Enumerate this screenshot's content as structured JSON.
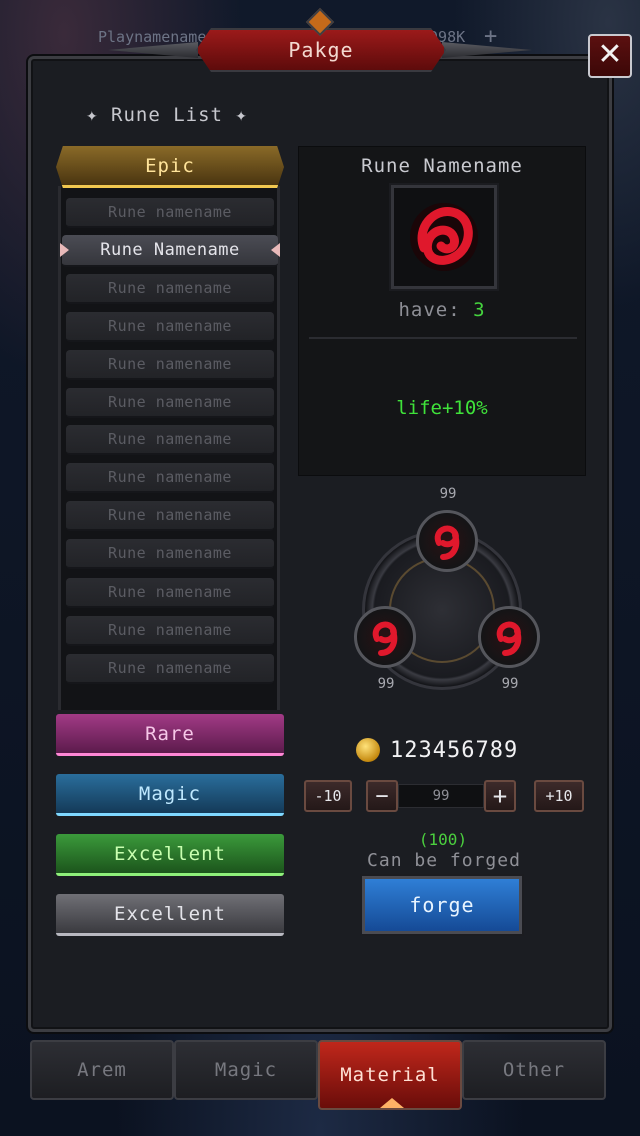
{
  "header": {
    "player_name": "Playnamename",
    "currency": "9098K",
    "plus_symbol": "+",
    "title": "Pakge",
    "close_symbol": "✕"
  },
  "rune_list": {
    "title": "✦ Rune List ✦",
    "categories": [
      {
        "label": "Epic",
        "color": "#f2c850"
      },
      {
        "label": "Rare",
        "color": "#ff87d6"
      },
      {
        "label": "Magic",
        "color": "#7fd8ff"
      },
      {
        "label": "Excellent",
        "color": "#8ff07a"
      },
      {
        "label": "Excellent",
        "color": "#b8b8c0"
      }
    ],
    "items": [
      "Rune namename",
      "Rune Namename",
      "Rune namename",
      "Rune namename",
      "Rune namename",
      "Rune namename",
      "Rune namename",
      "Rune namename",
      "Rune namename",
      "Rune namename",
      "Rune namename",
      "Rune namename",
      "Rune namename"
    ],
    "selected_index": 1
  },
  "detail": {
    "name": "Rune Namename",
    "icon": "red-rune-icon",
    "have_label": "have:",
    "have_value": "3",
    "effect": "life+10%"
  },
  "forge": {
    "materials": [
      {
        "position": "top",
        "count": "99",
        "icon": "rune-glyph-icon"
      },
      {
        "position": "left",
        "count": "99",
        "icon": "rune-glyph-icon"
      },
      {
        "position": "right",
        "count": "99",
        "icon": "rune-glyph-icon"
      }
    ],
    "gold": "123456789",
    "minus10": "-10",
    "minus": "−",
    "quantity": "99",
    "plus": "+",
    "plus10": "+10",
    "count": "(100)",
    "status": "Can be forged",
    "button": "forge"
  },
  "tabs": [
    {
      "label": "Arem"
    },
    {
      "label": "Magic"
    },
    {
      "label": "Material",
      "active": true
    },
    {
      "label": "Other"
    }
  ]
}
